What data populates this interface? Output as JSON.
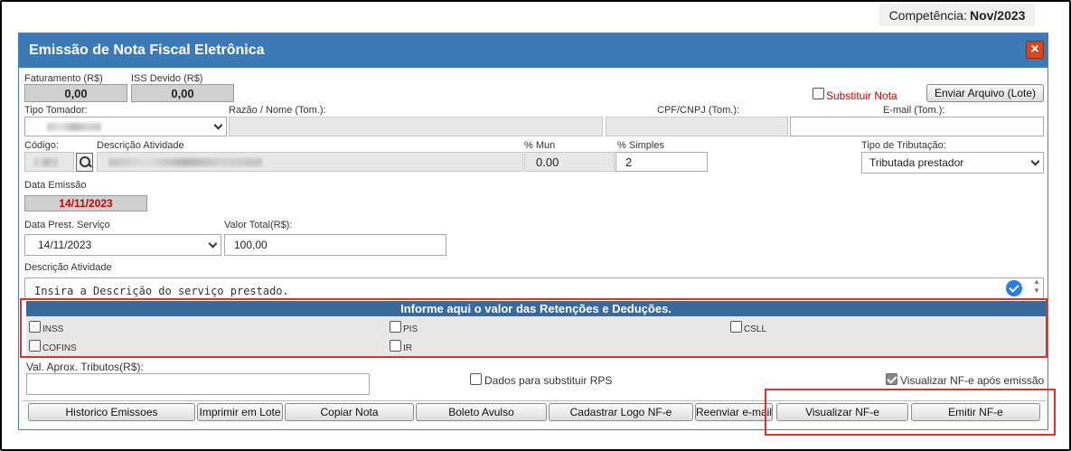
{
  "competencia": {
    "label": "Competência:",
    "value": "Nov/2023"
  },
  "dialog": {
    "title": "Emissão de Nota Fiscal Eletrônica",
    "close_symbol": "×"
  },
  "faturamento": {
    "label": "Faturamento (R$)",
    "value": "0,00"
  },
  "iss_devido": {
    "label": "ISS Devido (R$)",
    "value": "0,00"
  },
  "substituir_nota": {
    "label": "Substituir Nota",
    "checked": false
  },
  "enviar_arquivo_label": "Enviar Arquivo (Lote)",
  "tipo_tomador": {
    "label": "Tipo Tomador:"
  },
  "razao_nome": {
    "label": "Razão / Nome (Tom.):",
    "value": ""
  },
  "cpf_cnpj": {
    "label": "CPF/CNPJ (Tom.):",
    "value": ""
  },
  "email": {
    "label": "E-mail (Tom.):",
    "value": ""
  },
  "codigo": {
    "label": "Código:"
  },
  "descricao_atividade_top": {
    "label": "Descrição Atividade"
  },
  "mun": {
    "label": "% Mun",
    "value": "0.00"
  },
  "simples": {
    "label": "% Simples",
    "value": "2"
  },
  "tipo_tributacao": {
    "label": "Tipo de Tributação:",
    "value": "Tributada prestador"
  },
  "data_emissao": {
    "label": "Data Emissão",
    "value": "14/11/2023"
  },
  "data_prest": {
    "label": "Data Prest. Serviço",
    "value": "14/11/2023"
  },
  "valor_total": {
    "label": "Valor Total(R$):",
    "value": "100,00"
  },
  "descricao_atividade": {
    "label": "Descrição Atividade",
    "placeholder": "Insira a Descrição do serviço prestado."
  },
  "retencoes": {
    "header": "Informe aqui o valor das Retenções e Deduções.",
    "inss": "INSS",
    "pis": "PIS",
    "csll": "CSLL",
    "cofins": "COFINS",
    "ir": "IR"
  },
  "val_aprox": {
    "label": "Val. Aprox. Tributos(R$):",
    "value": ""
  },
  "dados_substituir": {
    "label": "Dados para substituir RPS",
    "checked": false
  },
  "visualizar_apos": {
    "label": "Visualizar NF-e após emissão",
    "checked": true
  },
  "buttons": {
    "historico": "Historico Emissoes",
    "imprimir": "Imprimir em Lote",
    "copiar": "Copiar Nota",
    "boleto": "Boleto Avulso",
    "cadastrar_logo": "Cadastrar Logo NF-e",
    "reenviar": "Reenviar e-mail",
    "visualizar": "Visualizar NF-e",
    "emitir": "Emitir NF-e"
  },
  "colors": {
    "title_bar": "#3d7ab5",
    "retencoes_header": "#3a6a9a",
    "highlight_outline": "#e0302a",
    "date_red": "#cc0000"
  }
}
